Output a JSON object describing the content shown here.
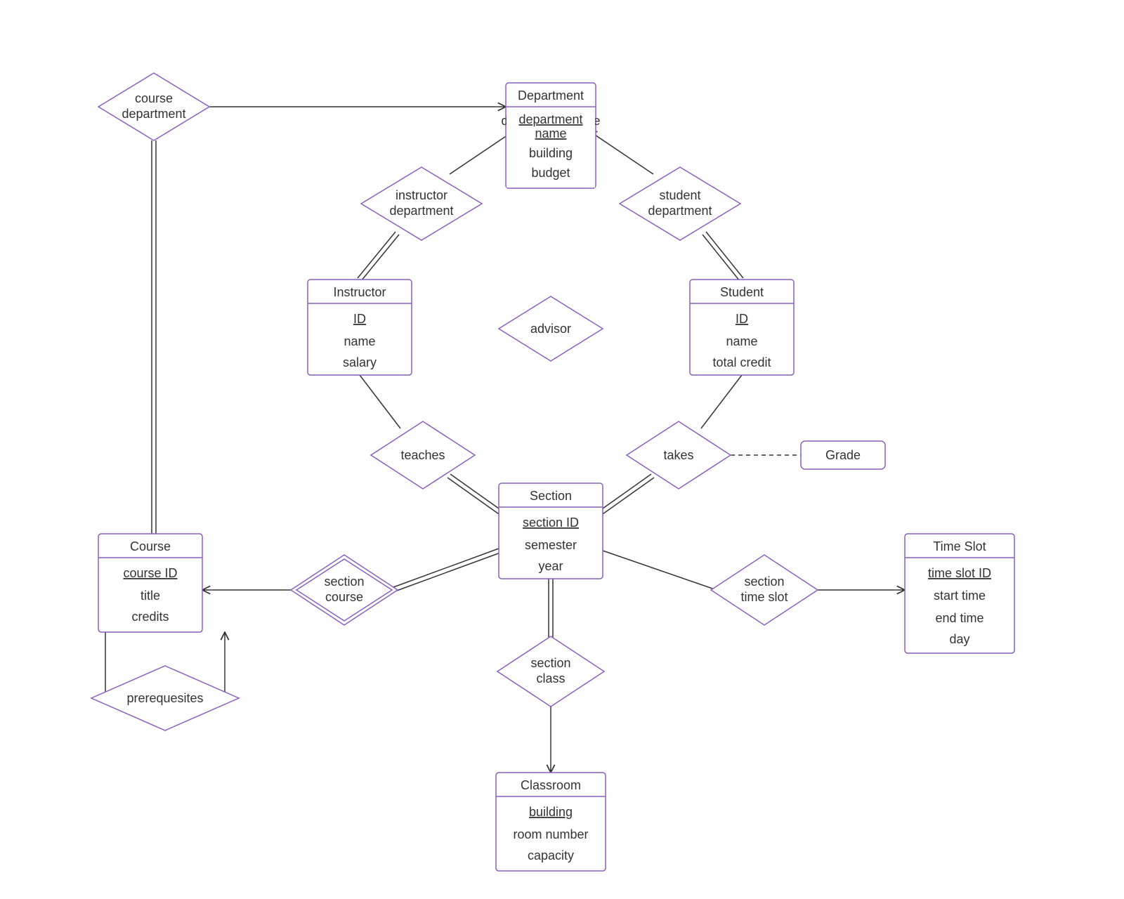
{
  "entities": {
    "department": {
      "title": "Department",
      "attrs": [
        "department name",
        "building",
        "budget"
      ],
      "keys": [
        0
      ]
    },
    "instructor": {
      "title": "Instructor",
      "attrs": [
        "ID",
        "name",
        "salary"
      ],
      "keys": [
        0
      ]
    },
    "student": {
      "title": "Student",
      "attrs": [
        "ID",
        "name",
        "total credit"
      ],
      "keys": [
        0
      ]
    },
    "section": {
      "title": "Section",
      "attrs": [
        "section ID",
        "semester",
        "year"
      ],
      "keys": [
        0
      ]
    },
    "course": {
      "title": "Course",
      "attrs": [
        "course ID",
        "title",
        "credits"
      ],
      "keys": [
        0
      ]
    },
    "classroom": {
      "title": "Classroom",
      "attrs": [
        "building",
        "room number",
        "capacity"
      ],
      "keys": [
        0
      ]
    },
    "timeslot": {
      "title": "Time Slot",
      "attrs": [
        "time slot ID",
        "start time",
        "end time",
        "day"
      ],
      "keys": [
        0
      ]
    }
  },
  "relationships": {
    "course_department": {
      "label1": "course",
      "label2": "department"
    },
    "instructor_department": {
      "label1": "instructor",
      "label2": "department"
    },
    "student_department": {
      "label1": "student",
      "label2": "department"
    },
    "advisor": {
      "label": "advisor"
    },
    "teaches": {
      "label": "teaches"
    },
    "takes": {
      "label": "takes"
    },
    "section_course": {
      "label1": "section",
      "label2": "course"
    },
    "section_class": {
      "label1": "section",
      "label2": "class"
    },
    "section_time_slot": {
      "label1": "section",
      "label2": "time slot"
    },
    "prerequisites": {
      "label": "prerequesites"
    }
  },
  "rel_attribute": {
    "grade": "Grade"
  }
}
